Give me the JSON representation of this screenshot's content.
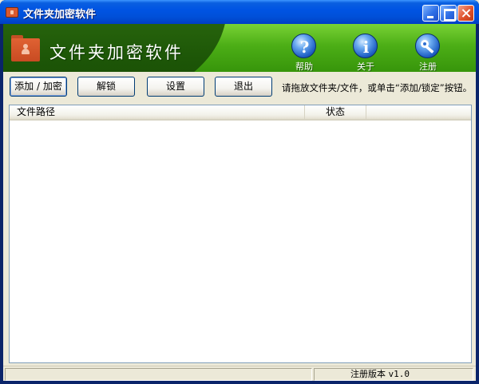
{
  "window": {
    "title": "文件夹加密软件"
  },
  "banner": {
    "title": "文件夹加密软件",
    "buttons": [
      {
        "icon": "help-icon",
        "label": "帮助"
      },
      {
        "icon": "info-icon",
        "label": "关于"
      },
      {
        "icon": "key-icon",
        "label": "注册"
      }
    ]
  },
  "toolbar": {
    "add_label": "添加 / 加密",
    "unlock_label": "解锁",
    "settings_label": "设置",
    "exit_label": "退出",
    "hint": "请拖放文件夹/文件，或单击“添加/锁定”按钮。"
  },
  "list": {
    "columns": [
      "文件路径",
      "状态"
    ],
    "rows": []
  },
  "statusbar": {
    "left": "",
    "version_prefix": "注册版本",
    "version": "v1.0"
  },
  "colors": {
    "banner_green": "#4cae16",
    "title_blue": "#0054e3",
    "logo_orange": "#d9592f"
  }
}
